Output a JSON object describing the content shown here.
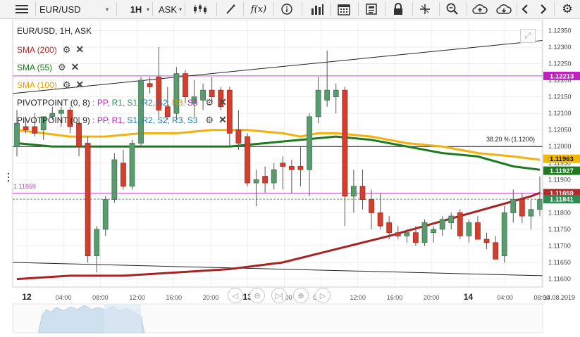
{
  "toolbar": {
    "symbol": "EUR/USD",
    "timeframe": "1H",
    "price_type": "ASK",
    "indicator_label": "f(x)",
    "icons": [
      "menu-icon",
      "symbol-dropdown-icon",
      "timeframe-dropdown-icon",
      "price-type-dropdown-icon",
      "candlestick-icon",
      "draw-icon",
      "function-icon",
      "info-icon",
      "volume-bars-icon",
      "calendar-icon",
      "news-icon",
      "lock-icon",
      "crosshair-icon",
      "zoom-icon",
      "cloud-upload-icon",
      "cloud-download-icon",
      "prev-icon",
      "next-icon",
      "settings-icon"
    ]
  },
  "legend": {
    "header": "EUR/USD, 1H, ASK",
    "indicators": [
      {
        "name": "SMA (200)",
        "color": "#b22a2a"
      },
      {
        "name": "SMA (55)",
        "color": "#1a7a1a"
      },
      {
        "name": "SMA (100)",
        "color": "#f2a900"
      }
    ],
    "pivots": [
      {
        "name": "PIVOTPOINT (0, 8)",
        "sep": " : ",
        "labels": [
          {
            "t": "PP",
            "c": "#c020c0"
          },
          {
            "t": "R1",
            "c": "#2a9a5a"
          },
          {
            "t": "S1",
            "c": "#2a9a5a"
          },
          {
            "t": "R2",
            "c": "#1a7ab0"
          },
          {
            "t": "S2",
            "c": "#1a7ab0"
          },
          {
            "t": "R3",
            "c": "#c8a000"
          },
          {
            "t": "S3",
            "c": "#c020c0"
          }
        ]
      },
      {
        "name": "PIVOTPOINT (0, 9)",
        "sep": " : ",
        "labels": [
          {
            "t": "PP",
            "c": "#c020c0"
          },
          {
            "t": "R1",
            "c": "#c020c0"
          },
          {
            "t": "S1",
            "c": "#1a7ab0"
          },
          {
            "t": "R2",
            "c": "#1a7ab0"
          },
          {
            "t": "S2",
            "c": "#1a7ab0"
          },
          {
            "t": "R3",
            "c": "#1a7ab0"
          },
          {
            "t": "S3",
            "c": "#1a7ab0"
          }
        ]
      }
    ]
  },
  "price_axis": [
    "1.12350",
    "1.12300",
    "1.12250",
    "1.12200",
    "1.12150",
    "1.12100",
    "1.12050",
    "1.12000",
    "1.11950",
    "1.11900",
    "1.11850",
    "1.11800",
    "1.11750",
    "1.11700",
    "1.11650",
    "1.11600"
  ],
  "price_tags": [
    {
      "label": "1.12213",
      "bg": "#c020c0",
      "fg": "#ffffff",
      "value": 1.12213
    },
    {
      "label": "1.11963",
      "bg": "#f2b800",
      "fg": "#111111",
      "value": 1.11963
    },
    {
      "label": "1.11927",
      "bg": "#1e7a1e",
      "fg": "#ffffff",
      "value": 1.11927
    },
    {
      "label": "1.11859",
      "bg": "#b22a2a",
      "fg": "#ffffff",
      "value": 1.11859
    },
    {
      "label": "1.11841",
      "bg": "#2e8a4e",
      "fg": "#ffffff",
      "value": 1.11841
    }
  ],
  "left_price_label": "1.11859",
  "fib_label": "38.20 % (1.1200)",
  "time_axis": {
    "labels": [
      {
        "t": "12",
        "bold": true
      },
      {
        "t": "04:00"
      },
      {
        "t": "08:00"
      },
      {
        "t": "12:00"
      },
      {
        "t": "16:00"
      },
      {
        "t": "20:00"
      },
      {
        "t": "13",
        "bold": true
      },
      {
        "t": "04:00"
      },
      {
        "t": "08:00"
      },
      {
        "t": "12:00"
      },
      {
        "t": "16:00"
      },
      {
        "t": "20:00"
      },
      {
        "t": "14",
        "bold": true
      },
      {
        "t": "04:00"
      },
      {
        "t": "08:00"
      }
    ],
    "date_right": "14.08.2019"
  },
  "nav_controls": [
    {
      "name": "scroll-left-button",
      "glyph": "◁"
    },
    {
      "name": "zoom-out-button",
      "glyph": "⊖"
    },
    {
      "name": "reset-button",
      "glyph": "▷|"
    },
    {
      "name": "zoom-in-button",
      "glyph": "⊕"
    },
    {
      "name": "scroll-right-button",
      "glyph": "▷"
    }
  ],
  "chart_data": {
    "type": "candlestick",
    "symbol": "EUR/USD",
    "interval": "1H",
    "ylim": [
      1.1158,
      1.1237
    ],
    "candles": [
      {
        "o": 1.12,
        "h": 1.1211,
        "l": 1.1197,
        "c": 1.1207
      },
      {
        "o": 1.1206,
        "h": 1.1209,
        "l": 1.1204,
        "c": 1.1205
      },
      {
        "o": 1.1206,
        "h": 1.121,
        "l": 1.1203,
        "c": 1.1204
      },
      {
        "o": 1.1205,
        "h": 1.1209,
        "l": 1.1202,
        "c": 1.1209
      },
      {
        "o": 1.1209,
        "h": 1.1212,
        "l": 1.1208,
        "c": 1.121
      },
      {
        "o": 1.121,
        "h": 1.1212,
        "l": 1.1206,
        "c": 1.1211
      },
      {
        "o": 1.1211,
        "h": 1.1212,
        "l": 1.1204,
        "c": 1.1206
      },
      {
        "o": 1.1207,
        "h": 1.1209,
        "l": 1.1197,
        "c": 1.12
      },
      {
        "o": 1.1201,
        "h": 1.1203,
        "l": 1.1165,
        "c": 1.1167
      },
      {
        "o": 1.1167,
        "h": 1.1176,
        "l": 1.1162,
        "c": 1.1175
      },
      {
        "o": 1.1175,
        "h": 1.1185,
        "l": 1.1173,
        "c": 1.1184
      },
      {
        "o": 1.1184,
        "h": 1.1198,
        "l": 1.1183,
        "c": 1.1196
      },
      {
        "o": 1.1195,
        "h": 1.1199,
        "l": 1.1187,
        "c": 1.1188
      },
      {
        "o": 1.1188,
        "h": 1.1202,
        "l": 1.1187,
        "c": 1.1201
      },
      {
        "o": 1.1201,
        "h": 1.1221,
        "l": 1.12,
        "c": 1.122
      },
      {
        "o": 1.1219,
        "h": 1.1221,
        "l": 1.1216,
        "c": 1.1218
      },
      {
        "o": 1.1221,
        "h": 1.123,
        "l": 1.1209,
        "c": 1.1211
      },
      {
        "o": 1.1212,
        "h": 1.1218,
        "l": 1.1208,
        "c": 1.1209
      },
      {
        "o": 1.121,
        "h": 1.1224,
        "l": 1.1208,
        "c": 1.1222
      },
      {
        "o": 1.1222,
        "h": 1.1223,
        "l": 1.1213,
        "c": 1.1215
      },
      {
        "o": 1.1213,
        "h": 1.122,
        "l": 1.1209,
        "c": 1.1215
      },
      {
        "o": 1.1214,
        "h": 1.1219,
        "l": 1.1211,
        "c": 1.1217
      },
      {
        "o": 1.1217,
        "h": 1.1221,
        "l": 1.1213,
        "c": 1.1215
      },
      {
        "o": 1.1217,
        "h": 1.1218,
        "l": 1.1211,
        "c": 1.1212
      },
      {
        "o": 1.1217,
        "h": 1.1218,
        "l": 1.12,
        "c": 1.1204
      },
      {
        "o": 1.1205,
        "h": 1.1211,
        "l": 1.1199,
        "c": 1.1201
      },
      {
        "o": 1.1203,
        "h": 1.1204,
        "l": 1.1188,
        "c": 1.1189
      },
      {
        "o": 1.1189,
        "h": 1.1193,
        "l": 1.1182,
        "c": 1.119
      },
      {
        "o": 1.1191,
        "h": 1.1194,
        "l": 1.1186,
        "c": 1.1189
      },
      {
        "o": 1.1189,
        "h": 1.1195,
        "l": 1.1187,
        "c": 1.1193
      },
      {
        "o": 1.1195,
        "h": 1.1197,
        "l": 1.1187,
        "c": 1.1194
      },
      {
        "o": 1.1194,
        "h": 1.1196,
        "l": 1.1186,
        "c": 1.1193
      },
      {
        "o": 1.1194,
        "h": 1.12,
        "l": 1.1188,
        "c": 1.1193
      },
      {
        "o": 1.1193,
        "h": 1.121,
        "l": 1.1185,
        "c": 1.1209
      },
      {
        "o": 1.1209,
        "h": 1.1221,
        "l": 1.1207,
        "c": 1.1217
      },
      {
        "o": 1.1214,
        "h": 1.1229,
        "l": 1.1212,
        "c": 1.1217
      },
      {
        "o": 1.1215,
        "h": 1.1219,
        "l": 1.121,
        "c": 1.1217
      },
      {
        "o": 1.1217,
        "h": 1.1218,
        "l": 1.1176,
        "c": 1.1185
      },
      {
        "o": 1.1185,
        "h": 1.1193,
        "l": 1.118,
        "c": 1.1188
      },
      {
        "o": 1.1188,
        "h": 1.1193,
        "l": 1.1181,
        "c": 1.1184
      },
      {
        "o": 1.1184,
        "h": 1.1187,
        "l": 1.1175,
        "c": 1.118
      },
      {
        "o": 1.118,
        "h": 1.1186,
        "l": 1.1175,
        "c": 1.1176
      },
      {
        "o": 1.1177,
        "h": 1.1179,
        "l": 1.1172,
        "c": 1.1174
      },
      {
        "o": 1.1174,
        "h": 1.1176,
        "l": 1.1172,
        "c": 1.1173
      },
      {
        "o": 1.1173,
        "h": 1.1175,
        "l": 1.1171,
        "c": 1.1174
      },
      {
        "o": 1.1174,
        "h": 1.1176,
        "l": 1.117,
        "c": 1.1171
      },
      {
        "o": 1.1171,
        "h": 1.1178,
        "l": 1.117,
        "c": 1.1177
      },
      {
        "o": 1.1174,
        "h": 1.1176,
        "l": 1.1171,
        "c": 1.1175
      },
      {
        "o": 1.1175,
        "h": 1.1179,
        "l": 1.1173,
        "c": 1.1178
      },
      {
        "o": 1.1177,
        "h": 1.118,
        "l": 1.1175,
        "c": 1.1179
      },
      {
        "o": 1.118,
        "h": 1.1181,
        "l": 1.1172,
        "c": 1.1173
      },
      {
        "o": 1.1173,
        "h": 1.1178,
        "l": 1.1171,
        "c": 1.1177
      },
      {
        "o": 1.1177,
        "h": 1.1179,
        "l": 1.1172,
        "c": 1.1172
      },
      {
        "o": 1.1172,
        "h": 1.1174,
        "l": 1.1169,
        "c": 1.1171
      },
      {
        "o": 1.1171,
        "h": 1.1173,
        "l": 1.1166,
        "c": 1.1166
      },
      {
        "o": 1.1167,
        "h": 1.1182,
        "l": 1.1165,
        "c": 1.118
      },
      {
        "o": 1.118,
        "h": 1.1187,
        "l": 1.1177,
        "c": 1.1184
      },
      {
        "o": 1.1184,
        "h": 1.1186,
        "l": 1.1177,
        "c": 1.1179
      },
      {
        "o": 1.1179,
        "h": 1.1184,
        "l": 1.1175,
        "c": 1.1181
      },
      {
        "o": 1.1181,
        "h": 1.1191,
        "l": 1.1179,
        "c": 1.1184
      }
    ],
    "sma200": [
      [
        0,
        1.116
      ],
      [
        6,
        1.1161
      ],
      [
        12,
        1.1161
      ],
      [
        18,
        1.1162
      ],
      [
        24,
        1.1163
      ],
      [
        30,
        1.1165
      ],
      [
        36,
        1.1169
      ],
      [
        42,
        1.1173
      ],
      [
        46,
        1.1176
      ],
      [
        50,
        1.1179
      ],
      [
        54,
        1.1182
      ],
      [
        58,
        1.1185
      ],
      [
        59,
        1.1186
      ]
    ],
    "sma55": [
      [
        0,
        1.1201
      ],
      [
        4,
        1.12
      ],
      [
        8,
        1.12
      ],
      [
        12,
        1.12
      ],
      [
        16,
        1.12
      ],
      [
        20,
        1.12
      ],
      [
        24,
        1.12
      ],
      [
        28,
        1.1201
      ],
      [
        32,
        1.1202
      ],
      [
        36,
        1.1203
      ],
      [
        40,
        1.1202
      ],
      [
        44,
        1.12
      ],
      [
        48,
        1.1198
      ],
      [
        52,
        1.1197
      ],
      [
        56,
        1.1194
      ],
      [
        59,
        1.1193
      ]
    ],
    "sma100": [
      [
        0,
        1.1205
      ],
      [
        3,
        1.1204
      ],
      [
        6,
        1.1203
      ],
      [
        10,
        1.1203
      ],
      [
        14,
        1.1204
      ],
      [
        18,
        1.1204
      ],
      [
        22,
        1.1205
      ],
      [
        26,
        1.1205
      ],
      [
        30,
        1.1204
      ],
      [
        32,
        1.1203
      ],
      [
        34,
        1.1204
      ],
      [
        36,
        1.1204
      ],
      [
        40,
        1.1203
      ],
      [
        44,
        1.1201
      ],
      [
        48,
        1.12
      ],
      [
        52,
        1.1198
      ],
      [
        56,
        1.1197
      ],
      [
        59,
        1.1196
      ]
    ],
    "hlines": [
      {
        "value": 1.12213,
        "color": "#d044d0"
      },
      {
        "value": 1.11859,
        "color": "#c84ac8"
      },
      {
        "value": 1.11841,
        "color": "#5a9a6a",
        "dash": true
      },
      {
        "value": 1.12,
        "color": "#222222"
      }
    ],
    "trendlines": [
      {
        "from": [
          0,
          1.1216
        ],
        "to": [
          59,
          1.1232
        ],
        "color": "#222222"
      },
      {
        "from": [
          0,
          1.1165
        ],
        "to": [
          59,
          1.1161
        ],
        "color": "#222222"
      }
    ]
  }
}
